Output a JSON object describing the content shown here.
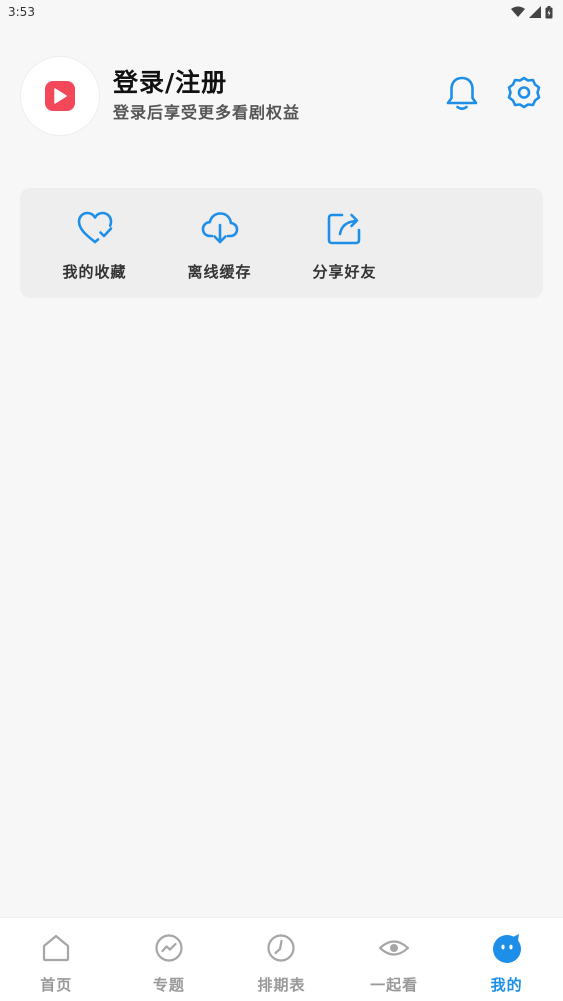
{
  "status_bar": {
    "time": "3:53"
  },
  "profile": {
    "title": "登录/注册",
    "subtitle": "登录后享受更多看剧权益"
  },
  "quick_actions": [
    {
      "label": "我的收藏",
      "icon": "heart-check-icon"
    },
    {
      "label": "离线缓存",
      "icon": "cloud-download-icon"
    },
    {
      "label": "分享好友",
      "icon": "share-icon"
    }
  ],
  "tabs": [
    {
      "label": "首页",
      "icon": "home-icon",
      "active": false
    },
    {
      "label": "专题",
      "icon": "trend-icon",
      "active": false
    },
    {
      "label": "排期表",
      "icon": "clock-icon",
      "active": false
    },
    {
      "label": "一起看",
      "icon": "eye-icon",
      "active": false
    },
    {
      "label": "我的",
      "icon": "mascot-icon",
      "active": true
    }
  ],
  "colors": {
    "accent": "#1e8fe8",
    "brand_red": "#f3475a",
    "tab_inactive": "#999999",
    "background": "#f7f7f8"
  }
}
